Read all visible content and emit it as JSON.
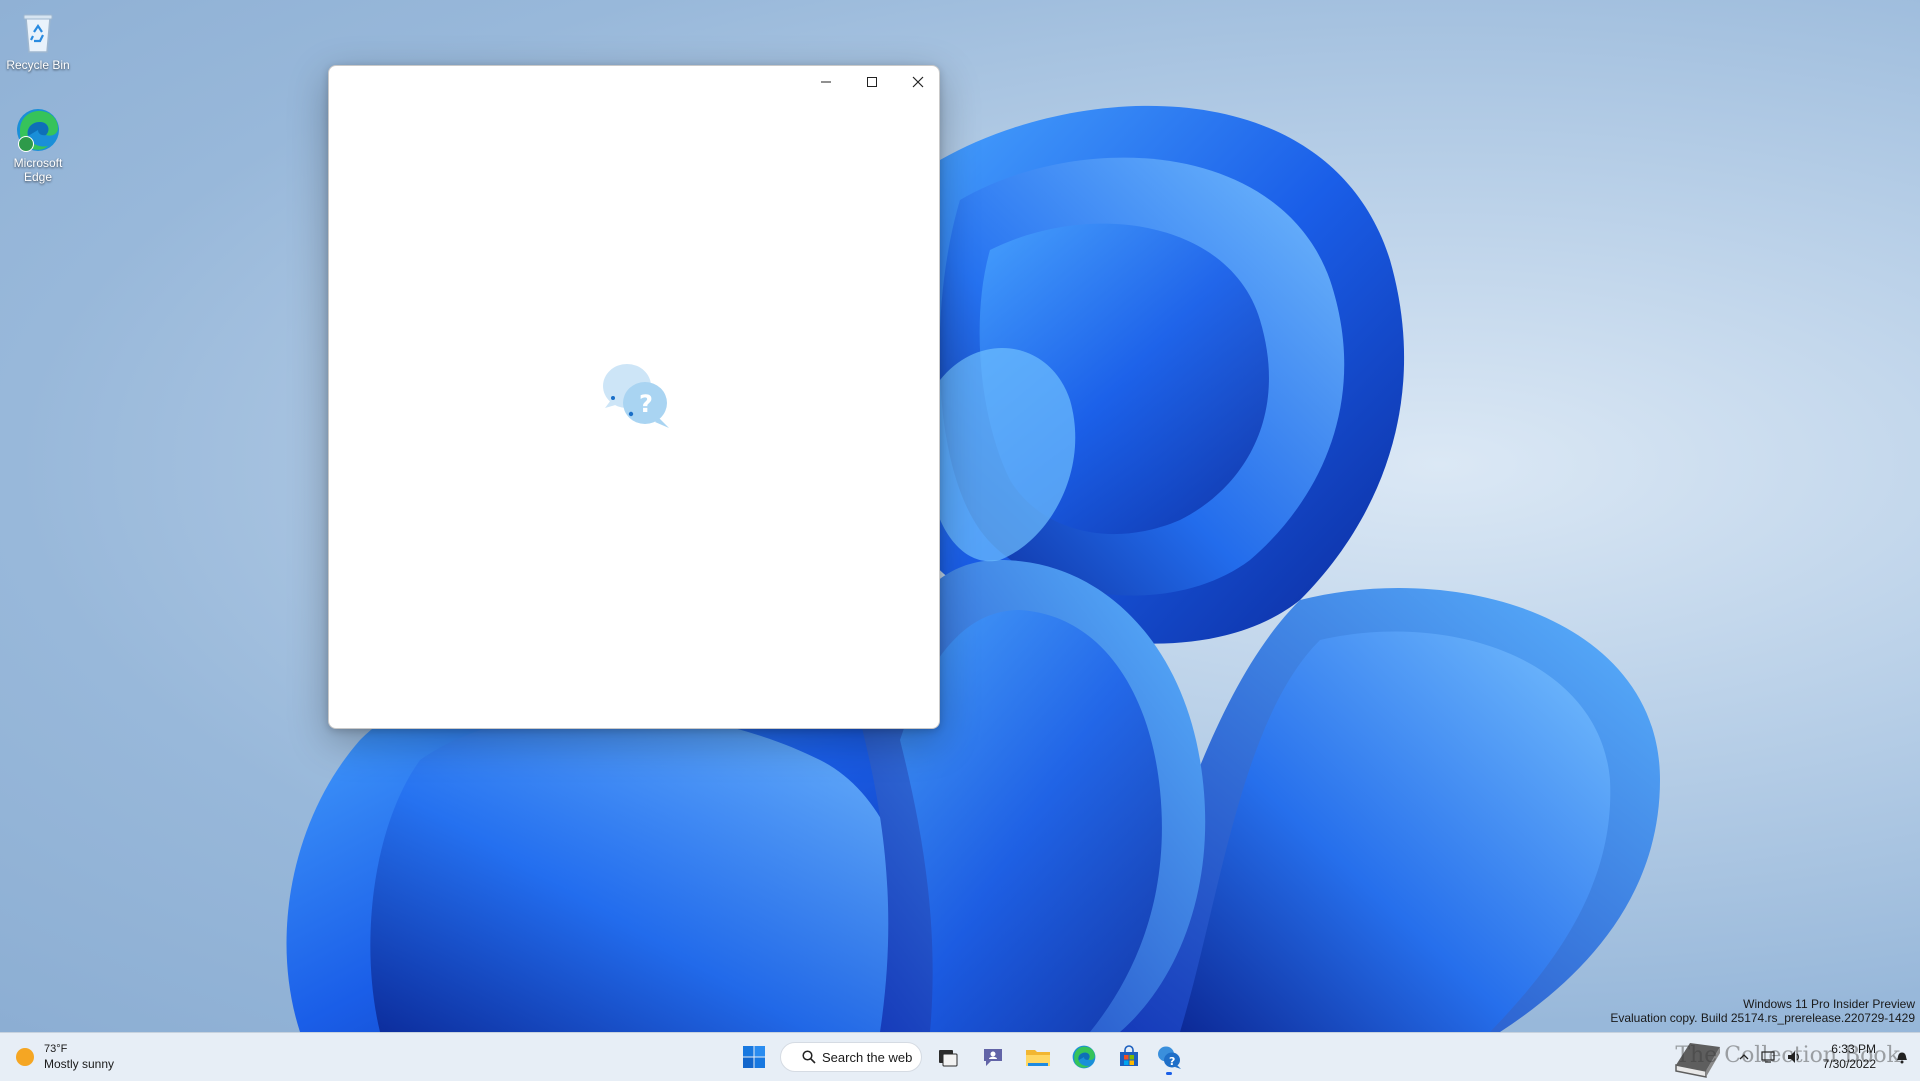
{
  "desktop": {
    "icons": [
      {
        "label": "Recycle Bin",
        "icon": "recycle-bin-icon"
      },
      {
        "label": "Microsoft Edge",
        "icon": "edge-icon"
      }
    ],
    "watermark": {
      "line1": "Windows 11 Pro Insider Preview",
      "line2": "Evaluation copy. Build 25174.rs_prerelease.220729-1429"
    },
    "accent_color": "#1a5ee8"
  },
  "window": {
    "buttons": {
      "minimize": "minimize-icon",
      "maximize": "maximize-icon",
      "close": "close-icon"
    },
    "content_icon": "get-help-loading-icon"
  },
  "taskbar": {
    "weather": {
      "temp": "73°F",
      "condition": "Mostly sunny"
    },
    "search": {
      "label": "Search the web"
    },
    "pinned": [
      "start-icon",
      "task-view-icon",
      "teams-chat-icon",
      "file-explorer-icon",
      "edge-icon",
      "store-icon",
      "get-help-icon"
    ],
    "tray": {
      "overlay_text": "The Collection Book",
      "time": "6:33 PM",
      "date": "7/30/2022",
      "icons": [
        "chevron-up-icon",
        "network-icon",
        "volume-icon",
        "notification-icon"
      ]
    }
  }
}
